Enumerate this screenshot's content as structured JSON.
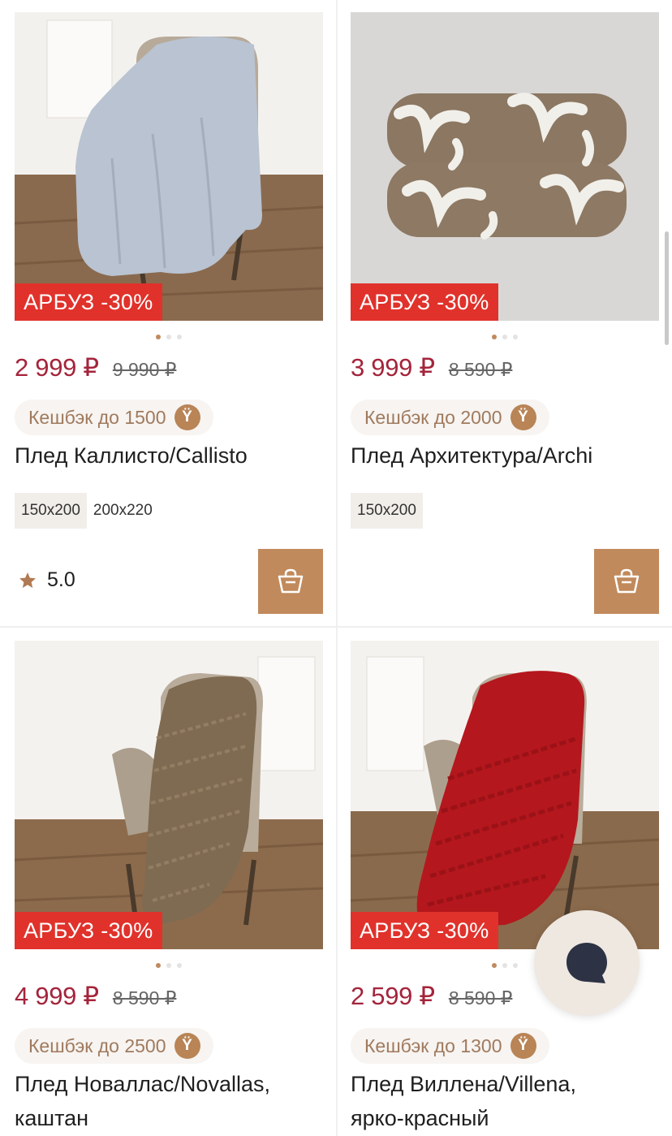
{
  "promo_label": "АРБУЗ -30%",
  "colors": {
    "promo": "#e0322b",
    "price": "#a4243b",
    "accent": "#c18a5c"
  },
  "products": [
    {
      "price": "2 999 ₽",
      "old_price": "9 990 ₽",
      "cashback": "Кешбэк до 1500",
      "cashback_icon": "Ÿ",
      "title": "Плед Каллисто/Callisto",
      "sizes": [
        "150x200",
        "200x220"
      ],
      "rating": "5.0",
      "image": "light-blue-blanket-on-chair"
    },
    {
      "price": "3 999 ₽",
      "old_price": "8 590 ₽",
      "cashback": "Кешбэк до 2000",
      "cashback_icon": "Ÿ",
      "title": "Плед Архитектура/Archi",
      "sizes": [
        "150x200"
      ],
      "image": "folded-brown-blanket-with-bows"
    },
    {
      "price": "4 999 ₽",
      "old_price": "8 590 ₽",
      "cashback": "Кешбэк до 2500",
      "cashback_icon": "Ÿ",
      "title_line1": "Плед Новаллас/Novallas,",
      "title_line2": "каштан",
      "image": "brown-knit-blanket-on-chair"
    },
    {
      "price": "2 599 ₽",
      "old_price": "8 590 ₽",
      "cashback": "Кешбэк до 1300",
      "cashback_icon": "Ÿ",
      "title_line1": "Плед Виллена/Villena,",
      "title_line2": "ярко-красный",
      "image": "red-knit-blanket-on-chair"
    }
  ]
}
